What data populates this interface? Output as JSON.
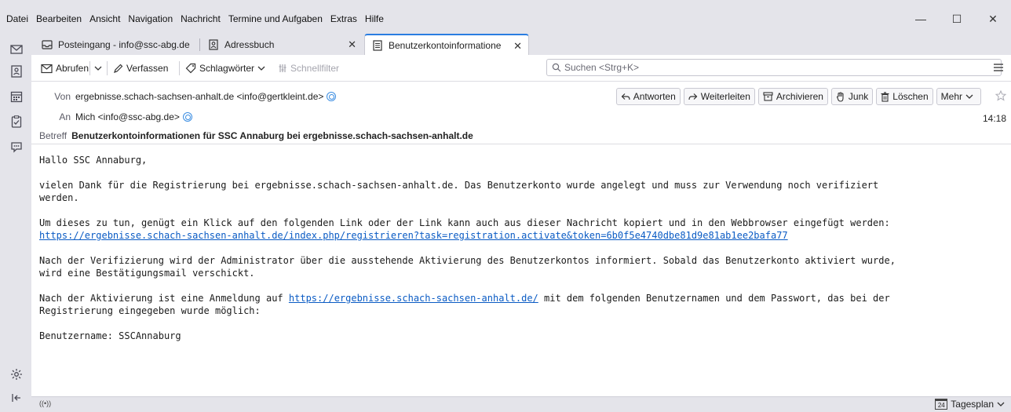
{
  "menubar": {
    "items": [
      "Datei",
      "Bearbeiten",
      "Ansicht",
      "Navigation",
      "Nachricht",
      "Termine und Aufgaben",
      "Extras",
      "Hilfe"
    ]
  },
  "window_controls": {
    "minimize": "—",
    "maximize": "☐",
    "close": "✕"
  },
  "tabs": [
    {
      "label": "Posteingang - info@ssc-abg.de",
      "icon": "inbox-icon"
    },
    {
      "label": "Adressbuch",
      "icon": "addressbook-icon",
      "close": "✕"
    },
    {
      "label": "Benutzerkontoinformatione",
      "icon": "message-icon",
      "close": "✕",
      "active": true
    }
  ],
  "toolbar": {
    "get_messages": "Abrufen",
    "compose": "Verfassen",
    "tags": "Schlagwörter",
    "quick_filter": "Schnellfilter",
    "search_placeholder": "Suchen <Strg+K>"
  },
  "header": {
    "from_label": "Von",
    "from_value": "ergebnisse.schach-sachsen-anhalt.de <info@gertkleint.de>",
    "to_label": "An",
    "to_value": "Mich <info@ssc-abg.de>",
    "subject_label": "Betreff",
    "subject_value": "Benutzerkontoinformationen für SSC Annaburg bei ergebnisse.schach-sachsen-anhalt.de",
    "time": "14:18",
    "actions": {
      "reply": "Antworten",
      "forward": "Weiterleiten",
      "archive": "Archivieren",
      "junk": "Junk",
      "delete": "Löschen",
      "more": "Mehr"
    }
  },
  "message": {
    "greeting": "Hallo SSC Annaburg,",
    "p1": "vielen Dank für die Registrierung bei ergebnisse.schach-sachsen-anhalt.de. Das Benutzerkonto wurde angelegt und muss zur Verwendung noch verifiziert\nwerden.",
    "p2": "Um dieses zu tun, genügt ein Klick auf den folgenden Link oder der Link kann auch aus dieser Nachricht kopiert und in den Webbrowser eingefügt werden:",
    "activation_link": "https://ergebnisse.schach-sachsen-anhalt.de/index.php/registrieren?task=registration.activate&token=6b0f5e4740dbe81d9e81ab1ee2bafa77",
    "p3": "Nach der Verifizierung wird der Administrator über die ausstehende Aktivierung des Benutzerkontos informiert. Sobald das Benutzerkonto aktiviert wurde,\nwird eine Bestätigungsmail verschickt.",
    "p4_before": "Nach der Aktivierung ist eine Anmeldung auf ",
    "p4_link": "https://ergebnisse.schach-sachsen-anhalt.de/",
    "p4_after": " mit dem folgenden Benutzernamen und dem Passwort, das bei der\nRegistrierung eingegeben wurde möglich:",
    "username_line": "Benutzername: SSCAnnaburg"
  },
  "statusbar": {
    "calendar_day": "24",
    "today_pane": "Tagesplan"
  }
}
